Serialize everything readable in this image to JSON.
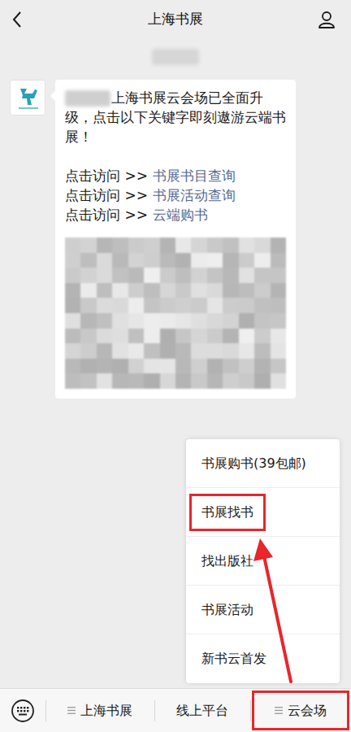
{
  "header": {
    "title": "上海书展"
  },
  "message": {
    "text": "上海书展云会场已全面升级，点击以下关键字即刻遨游云端书展！",
    "links": [
      {
        "prefix": "点击访问 >>",
        "label": "书展书目查询"
      },
      {
        "prefix": "点击访问 >>",
        "label": "书展活动查询"
      },
      {
        "prefix": "点击访问 >>",
        "label": "云端购书"
      }
    ]
  },
  "menu": {
    "items": [
      {
        "label": "书展购书(39包邮)",
        "annotated": false
      },
      {
        "label": "书展找书",
        "annotated": true
      },
      {
        "label": "找出版社",
        "annotated": false
      },
      {
        "label": "书展活动",
        "annotated": false
      },
      {
        "label": "新书云首发",
        "annotated": false
      }
    ]
  },
  "bottom_bar": {
    "tabs": [
      {
        "label": "上海书展",
        "has_submenu": true,
        "expanded": false,
        "annotated": false
      },
      {
        "label": "线上平台",
        "has_submenu": false,
        "expanded": false,
        "annotated": false
      },
      {
        "label": "云会场",
        "has_submenu": true,
        "expanded": true,
        "annotated": true
      }
    ]
  }
}
